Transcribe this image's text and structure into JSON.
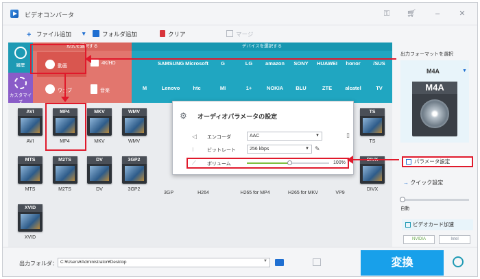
{
  "window": {
    "title": "ビデオコンバータ"
  },
  "toolbar": {
    "add_file": "ファイル追加",
    "add_folder": "フォルダ追加",
    "clear": "クリア",
    "merge": "マージ"
  },
  "categories": {
    "format_header": "形式を選択する",
    "device_header": "デバイスを選択する",
    "history": "履歴",
    "customize": "カスタマイズ",
    "video": "動画",
    "hd": "4K/HD",
    "web": "ウェブ",
    "audio": "音楽"
  },
  "brands_row1": [
    "",
    "SAMSUNG",
    "Microsoft",
    "G",
    "LG",
    "amazon",
    "SONY",
    "HUAWEI",
    "honor",
    "/SUS"
  ],
  "brands_row2": [
    "M",
    "Lenovo",
    "htc",
    "MI",
    "1+",
    "NOKIA",
    "BLU",
    "ZTE",
    "alcatel",
    "TV"
  ],
  "formats_row1": [
    "AVI",
    "MP4",
    "MKV",
    "WMV",
    "",
    "",
    "",
    "",
    "",
    "",
    "TS"
  ],
  "formats_row2": [
    "MTS",
    "M2TS",
    "DV",
    "3GP2",
    "3GP",
    "H264",
    "H265 for MP4",
    "H265 for MKV",
    "VP9",
    "DIVX"
  ],
  "formats_row3": [
    "XVID"
  ],
  "tile_tags_row2": [
    "MTS",
    "M2TS",
    "DV",
    "3GP2",
    "",
    "",
    "",
    "",
    "",
    "DIVX"
  ],
  "tile_tags_row3": [
    "XVID"
  ],
  "dialog": {
    "title": "オーディオパラメータの設定",
    "encoder_label": "エンコーダ",
    "encoder_value": "AAC",
    "bitrate_label": "ビットレート",
    "bitrate_value": "256 kbps",
    "volume_label": "ボリューム",
    "volume_value": "100%",
    "volume_level": 0.52
  },
  "right_panel": {
    "output_format_title": "出力フォーマットを選択",
    "selected_format": "M4A",
    "format_badge": "M4A",
    "param_settings": "パラメータ設定",
    "quick_settings": "クイック設定",
    "auto_label": "自動",
    "gpu_accel": "ビデオカード加速",
    "nvidia": "NVIDIA",
    "intel": "Intel"
  },
  "bottom": {
    "output_folder_label": "出力フォルダ：",
    "output_path": "C:¥Users¥Administrator¥Desktop",
    "convert": "変換"
  },
  "colors": {
    "accent_red": "#e0192b",
    "teal": "#20a6c1",
    "salmon": "#e2766e",
    "convert_blue": "#18a0ea"
  }
}
